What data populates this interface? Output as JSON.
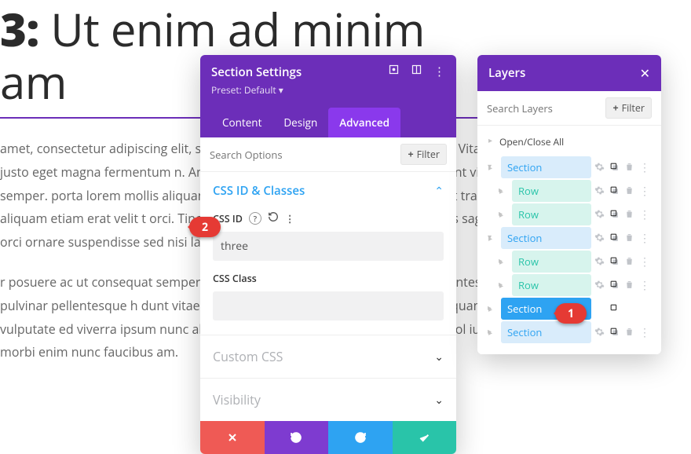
{
  "background": {
    "heading_prefix": " 3:",
    "heading_rest": " Ut enim ad minim",
    "heading_line2": "am",
    "para1": "amet, consectetur adipiscing elit, sed do                                           a aliqua auctor purus habitasse mod. Vitae justo eget magna fermentum                                           n. Amet tellus cras adipiscing volutpat ac tincidunt vitae semper.                                           porta lorem mollis aliquam n. Fermentum posuere urna nec tincidunt                                           tra aliquam etiam erat velit t orci. Tincidunt praesent semper feugiat                                           team ultrices sagittis orci ornare suspendisse sed nisi lacus.",
    "para2": "r posuere ac ut consequat semper. Etiam                                           llus faucibus scelerisque. Mi ris pellentesque pulvinar pellentesque h                                           dunt vitae semper quis lectus uismod. Risus pretium quam vulputate                                           ed viverra ipsum nunc aliquet rna. Neque gravida in fermentum et sol                                           ius morbi enim nunc faucibus am."
  },
  "settings": {
    "title": "Section Settings",
    "preset": "Preset: Default ▾",
    "tabs": {
      "content": "Content",
      "design": "Design",
      "advanced": "Advanced"
    },
    "search_placeholder": "Search Options",
    "filter_label": "Filter",
    "css_section_title": "CSS ID & Classes",
    "css_id_label": "CSS ID",
    "css_id_value": "three",
    "css_class_label": "CSS Class",
    "css_class_value": "",
    "custom_css_label": "Custom CSS",
    "visibility_label": "Visibility"
  },
  "layers": {
    "title": "Layers",
    "search_placeholder": "Search Layers",
    "filter_label": "Filter",
    "open_all": "Open/Close All",
    "items": [
      {
        "label": "Section",
        "type": "section",
        "indent": 0,
        "expanded": true,
        "active": false
      },
      {
        "label": "Row",
        "type": "row",
        "indent": 1,
        "expanded": false,
        "active": false
      },
      {
        "label": "Row",
        "type": "row",
        "indent": 1,
        "expanded": false,
        "active": false
      },
      {
        "label": "Section",
        "type": "section",
        "indent": 0,
        "expanded": true,
        "active": false
      },
      {
        "label": "Row",
        "type": "row",
        "indent": 1,
        "expanded": false,
        "active": false
      },
      {
        "label": "Row",
        "type": "row",
        "indent": 1,
        "expanded": false,
        "active": false
      },
      {
        "label": "Section",
        "type": "section",
        "indent": 0,
        "expanded": false,
        "active": true
      },
      {
        "label": "Section",
        "type": "section",
        "indent": 0,
        "expanded": false,
        "active": false
      }
    ]
  },
  "badges": {
    "one": "1",
    "two": "2"
  }
}
